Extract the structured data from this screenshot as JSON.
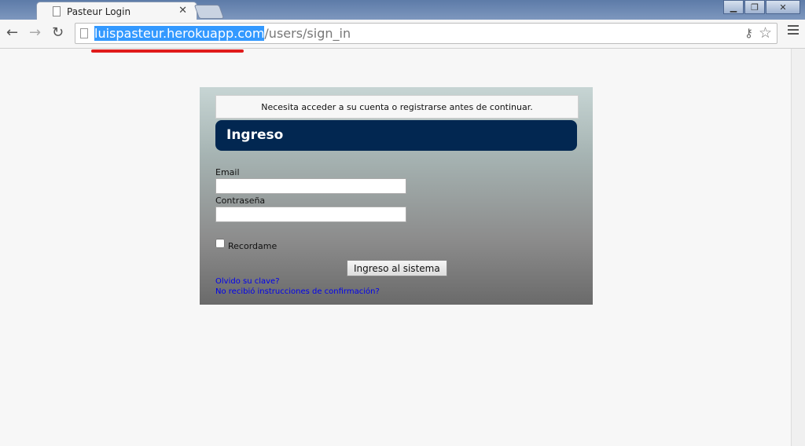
{
  "browser": {
    "tab_title": "Pasteur Login",
    "url_host": "luispasteur.herokuapp.com",
    "url_path": "/users/sign_in"
  },
  "page": {
    "notice": "Necesita acceder a su cuenta o registrarse antes de continuar.",
    "heading": "Ingreso",
    "email_label": "Email",
    "email_value": "",
    "password_label": "Contraseña",
    "password_value": "",
    "remember_label": "Recordame",
    "submit_label": "Ingreso al sistema",
    "forgot_link": "Olvido su clave?",
    "confirm_link": "No recibió instrucciones de confirmación?"
  },
  "colors": {
    "heading_bg": "#022751",
    "link": "#0000ee",
    "url_selection": "#3399ff"
  }
}
